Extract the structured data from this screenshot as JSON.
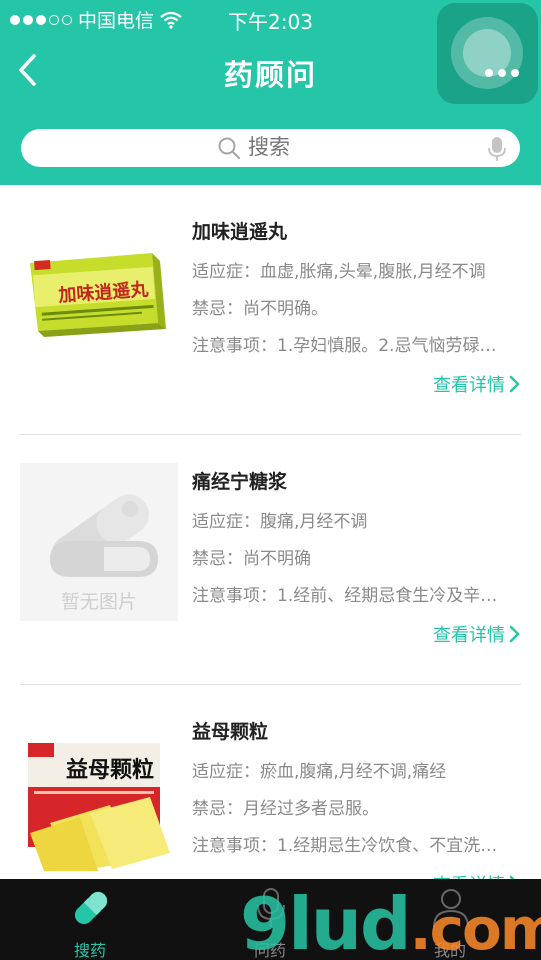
{
  "status_bar": {
    "carrier": "中国电信",
    "time": "下午2:03"
  },
  "header": {
    "title": "药顾问",
    "back_icon": "chevron-left-icon"
  },
  "search": {
    "placeholder": "搜索",
    "icons": [
      "search-icon",
      "microphone-icon"
    ]
  },
  "medicines": [
    {
      "name": "加味逍遥丸",
      "indications": "适应症：血虚,胀痛,头晕,腹胀,月经不调",
      "contraindications": "禁忌：尚不明确。",
      "precautions": "注意事项：1.孕妇慎服。2.忌气恼劳碌…",
      "detail_link": "查看详情",
      "image": "product-box-jiawei-xiaoyao-wan"
    },
    {
      "name": "痛经宁糖浆",
      "indications": "适应症：腹痛,月经不调",
      "contraindications": "禁忌：尚不明确",
      "precautions": "注意事项：1.经前、经期忌食生冷及辛…",
      "detail_link": "查看详情",
      "image": "placeholder",
      "image_placeholder_text": "暂无图片"
    },
    {
      "name": "益母颗粒",
      "indications": "适应症：瘀血,腹痛,月经不调,痛经",
      "contraindications": "禁忌：月经过多者忌服。",
      "precautions": "注意事项：1.经期忌生冷饮食、不宜洗…",
      "detail_link": "查看详情",
      "image": "product-box-yimu-keli"
    }
  ],
  "tabbar": {
    "tabs": [
      {
        "label": "搜药",
        "icon": "capsule-icon",
        "active": true
      },
      {
        "label": "问药",
        "icon": "microphone-icon",
        "active": false
      },
      {
        "label": "我的",
        "icon": "user-icon",
        "active": false
      }
    ]
  },
  "watermark": {
    "text": "9lud",
    "suffix": ".com"
  },
  "colors": {
    "accent": "#25c6a8",
    "tabbar_bg": "#111111",
    "text_secondary": "#8a8a8a"
  }
}
